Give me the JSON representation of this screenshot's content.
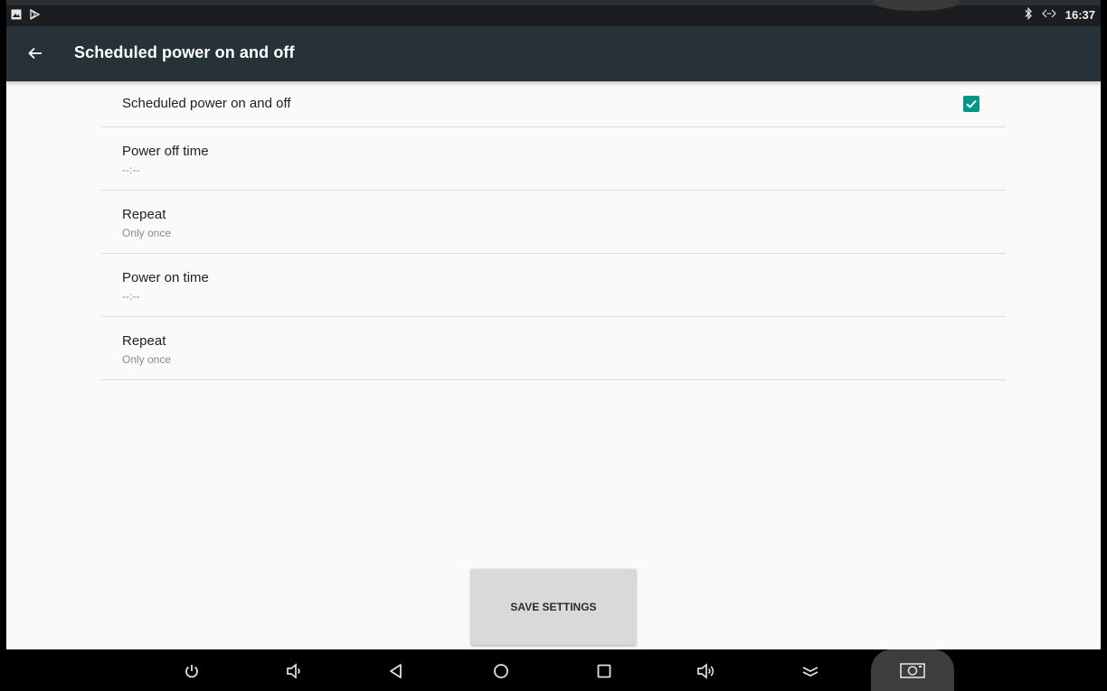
{
  "status_bar": {
    "left_icons": [
      "image-notification-icon",
      "play-store-notification-icon"
    ],
    "right_icons": [
      "bluetooth-icon",
      "ethernet-icon"
    ],
    "time": "16:37"
  },
  "app_bar": {
    "back_icon": "arrow-left-icon",
    "title": "Scheduled power on and off"
  },
  "settings": {
    "toggle": {
      "label": "Scheduled power on and off",
      "checked": true,
      "accent": "#009688"
    },
    "items": [
      {
        "title": "Power off time",
        "value": "--:--"
      },
      {
        "title": "Repeat",
        "value": "Only once"
      },
      {
        "title": "Power on time",
        "value": "--:--"
      },
      {
        "title": "Repeat",
        "value": "Only once"
      }
    ]
  },
  "save_button": {
    "label": "SAVE SETTINGS"
  },
  "nav_bar": {
    "buttons": [
      "power-icon",
      "volume-down-icon",
      "back-icon",
      "home-icon",
      "recents-icon",
      "volume-up-icon",
      "collapse-icon",
      "screenshot-icon"
    ]
  },
  "colors": {
    "app_bar": "#263238",
    "status_bar": "#1a1e21",
    "background": "#fafafa",
    "accent": "#009688"
  }
}
